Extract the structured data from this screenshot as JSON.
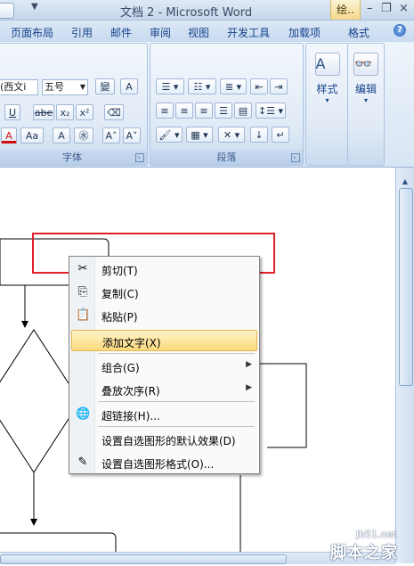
{
  "window": {
    "title": "文档 2 - Microsoft Word",
    "contextual_tab": "绘..",
    "minimize": "–",
    "restore": "❐",
    "close": "×"
  },
  "tabs": [
    "页面布局",
    "引用",
    "邮件",
    "审阅",
    "视图",
    "开发工具",
    "加载项",
    "格式"
  ],
  "help_label": "?",
  "ribbon": {
    "font_group": {
      "label": "字体",
      "font_name": "(西文i",
      "font_size": "五号",
      "buttons": [
        "U",
        "abe",
        "x₂",
        "x²",
        "A",
        "Aa",
        "A",
        "㊌",
        "A˄",
        "A˅"
      ]
    },
    "paragraph_group": {
      "label": "段落"
    },
    "styles_group": {
      "label": "样式"
    },
    "editing_group": {
      "label": "编辑"
    }
  },
  "context_menu": {
    "items": [
      {
        "label": "剪切(T)",
        "icon": "scissors-icon",
        "glyph": "✂"
      },
      {
        "label": "复制(C)",
        "icon": "copy-icon",
        "glyph": "⎘"
      },
      {
        "label": "粘贴(P)",
        "icon": "paste-icon",
        "glyph": "📋"
      },
      {
        "label": "添加文字(X)",
        "highlighted": true
      },
      {
        "label": "组合(G)",
        "submenu": true
      },
      {
        "label": "叠放次序(R)",
        "submenu": true
      },
      {
        "label": "超链接(H)...",
        "icon": "hyperlink-icon",
        "glyph": "🌐"
      },
      {
        "label": "设置自选图形的默认效果(D)"
      },
      {
        "label": "设置自选图形格式(O)...",
        "icon": "format-shape-icon",
        "glyph": "✎"
      }
    ]
  },
  "watermark": {
    "url": "jb51.net",
    "name": "脚本之家"
  },
  "colors": {
    "highlight_box": "#e0202c",
    "ribbon_blue": "#15428b",
    "menu_highlight": "#fbd97d"
  }
}
